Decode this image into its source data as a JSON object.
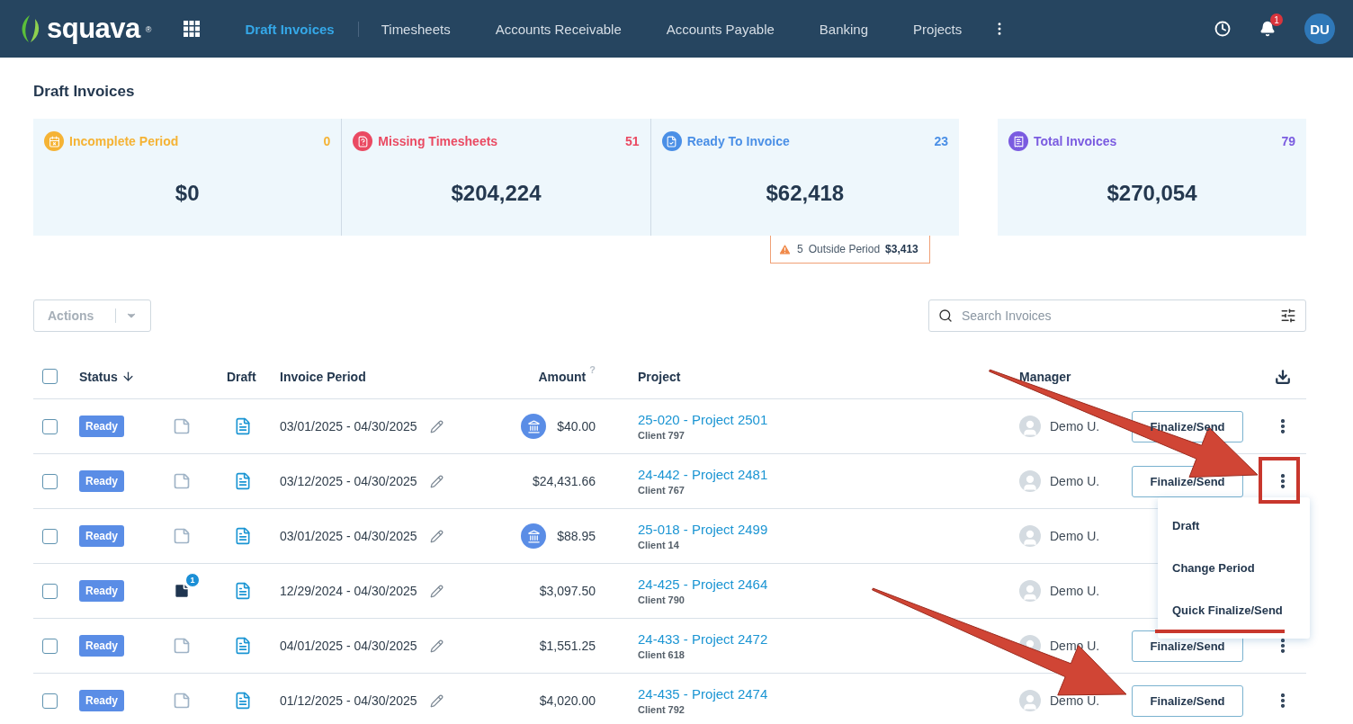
{
  "nav": {
    "logo": {
      "name": "squava",
      "mark": "®"
    },
    "items": [
      {
        "label": "Draft Invoices",
        "selected": true
      },
      {
        "label": "Timesheets",
        "selected": false
      },
      {
        "label": "Accounts Receivable",
        "selected": false
      },
      {
        "label": "Accounts Payable",
        "selected": false
      },
      {
        "label": "Banking",
        "selected": false
      },
      {
        "label": "Projects",
        "selected": false
      }
    ],
    "notifications": "1",
    "avatar": "DU"
  },
  "page_title": "Draft Invoices",
  "summary": [
    {
      "label": "Incomplete Period",
      "count": "0",
      "amount": "$0",
      "color": "#f5b335"
    },
    {
      "label": "Missing Timesheets",
      "count": "51",
      "amount": "$204,224",
      "color": "#ea4a62"
    },
    {
      "label": "Ready To Invoice",
      "count": "23",
      "amount": "$62,418",
      "color": "#4a8fe6"
    }
  ],
  "total": {
    "label": "Total Invoices",
    "count": "79",
    "amount": "$270,054",
    "color": "#7a5be0"
  },
  "warning": {
    "count": "5",
    "label": "Outside Period",
    "amount": "$3,413"
  },
  "actions": {
    "label": "Actions"
  },
  "search": {
    "placeholder": "Search Invoices"
  },
  "select_all": {
    "checked": false
  },
  "columns": [
    {
      "label": "Status",
      "sorted": true
    },
    {
      "label": "Draft",
      "sorted": false
    },
    {
      "label": "Invoice Period",
      "sorted": false
    },
    {
      "label": "Amount",
      "sorted": false,
      "help": "?"
    },
    {
      "label": "Project",
      "sorted": false
    },
    {
      "label": "Manager",
      "sorted": false
    }
  ],
  "rows": [
    {
      "checked": false,
      "status": "Ready",
      "has_notes": false,
      "period": "03/01/2025 - 04/30/2025",
      "bank": true,
      "amount": "$40.00",
      "project": "25-020 - Project 2501",
      "client": "Client 797",
      "manager": "Demo U.",
      "action": "Finalize/Send",
      "more": true,
      "menu_open": false
    },
    {
      "checked": false,
      "status": "Ready",
      "has_notes": false,
      "period": "03/12/2025 - 04/30/2025",
      "bank": false,
      "amount": "$24,431.66",
      "project": "24-442 - Project 2481",
      "client": "Client 767",
      "manager": "Demo U.",
      "action": "Finalize/Send",
      "more": true,
      "menu_open": true
    },
    {
      "checked": false,
      "status": "Ready",
      "has_notes": false,
      "period": "03/01/2025 - 04/30/2025",
      "bank": true,
      "amount": "$88.95",
      "project": "25-018 - Project 2499",
      "client": "Client 14",
      "manager": "Demo U.",
      "more": false,
      "menu_open": false
    },
    {
      "checked": false,
      "status": "Ready",
      "has_notes": true,
      "note_count": "1",
      "period": "12/29/2024 - 04/30/2025",
      "bank": false,
      "amount": "$3,097.50",
      "project": "24-425 - Project 2464",
      "client": "Client 790",
      "manager": "Demo U.",
      "more": false,
      "menu_open": false
    },
    {
      "checked": false,
      "status": "Ready",
      "has_notes": false,
      "period": "04/01/2025 - 04/30/2025",
      "bank": false,
      "amount": "$1,551.25",
      "project": "24-433 - Project 2472",
      "client": "Client 618",
      "manager": "Demo U.",
      "action": "Finalize/Send",
      "more": true,
      "menu_open": false
    },
    {
      "checked": false,
      "status": "Ready",
      "has_notes": false,
      "period": "01/12/2025 - 04/30/2025",
      "bank": false,
      "amount": "$4,020.00",
      "project": "24-435 - Project 2474",
      "client": "Client 792",
      "manager": "Demo U.",
      "action": "Finalize/Send",
      "more": true,
      "menu_open": false
    }
  ],
  "row_menu": [
    "Draft",
    "Change Period",
    "Quick Finalize/Send"
  ]
}
